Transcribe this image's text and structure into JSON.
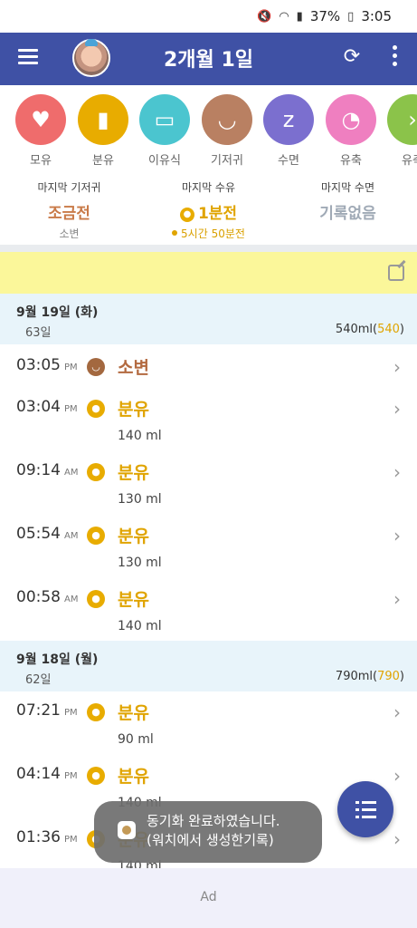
{
  "status_bar": {
    "battery": "37%",
    "time": "3:05"
  },
  "app_bar": {
    "title": "2개월 1일"
  },
  "categories": [
    {
      "label": "모유",
      "color": "#ef6c6c",
      "icon": "breastfeed-icon"
    },
    {
      "label": "분유",
      "color": "#e8ac00",
      "icon": "formula-bottle-icon"
    },
    {
      "label": "이유식",
      "color": "#4bc5cf",
      "icon": "baby-food-icon"
    },
    {
      "label": "기저귀",
      "color": "#b98062",
      "icon": "diaper-icon"
    },
    {
      "label": "수면",
      "color": "#7b6fcf",
      "icon": "sleep-icon"
    },
    {
      "label": "유축",
      "color": "#ef7fc0",
      "icon": "breast-pump-icon"
    },
    {
      "label": "유축",
      "color": "#8bc34a",
      "icon": "next-icon"
    }
  ],
  "summary": {
    "diaper": {
      "title": "마지막 기저귀",
      "value": "조금전",
      "sub": "소변"
    },
    "feeding": {
      "title": "마지막 수유",
      "value": "1분전",
      "sub": "5시간 50분전"
    },
    "sleep": {
      "title": "마지막 수면",
      "value": "기록없음"
    }
  },
  "days": [
    {
      "date": "9월 19일 (화)",
      "age": "63일",
      "total": "540ml",
      "total_paren": "540",
      "entries": [
        {
          "time": "03:05",
          "ampm": "PM",
          "type": "소변",
          "kind": "diaper"
        },
        {
          "time": "03:04",
          "ampm": "PM",
          "type": "분유",
          "amount": "140 ml",
          "kind": "formula"
        },
        {
          "time": "09:14",
          "ampm": "AM",
          "type": "분유",
          "amount": "130 ml",
          "kind": "formula"
        },
        {
          "time": "05:54",
          "ampm": "AM",
          "type": "분유",
          "amount": "130 ml",
          "kind": "formula"
        },
        {
          "time": "00:58",
          "ampm": "AM",
          "type": "분유",
          "amount": "140 ml",
          "kind": "formula"
        }
      ]
    },
    {
      "date": "9월 18일 (월)",
      "age": "62일",
      "total": "790ml",
      "total_paren": "790",
      "entries": [
        {
          "time": "07:21",
          "ampm": "PM",
          "type": "분유",
          "amount": "90 ml",
          "kind": "formula"
        },
        {
          "time": "04:14",
          "ampm": "PM",
          "type": "분유",
          "amount": "140 ml",
          "kind": "formula"
        },
        {
          "time": "01:36",
          "ampm": "PM",
          "type": "분유",
          "amount": "140 ml",
          "kind": "formula"
        }
      ]
    }
  ],
  "toast": {
    "line1": "동기화 완료하였습니다.",
    "line2": "(워치에서 생성한기록)"
  },
  "ad": {
    "label": "Ad"
  },
  "colors": {
    "primary": "#3f51a5",
    "memo": "#fbf79a",
    "day_header": "#e8f4fa",
    "formula": "#e0a400",
    "diaper": "#b36a40"
  }
}
